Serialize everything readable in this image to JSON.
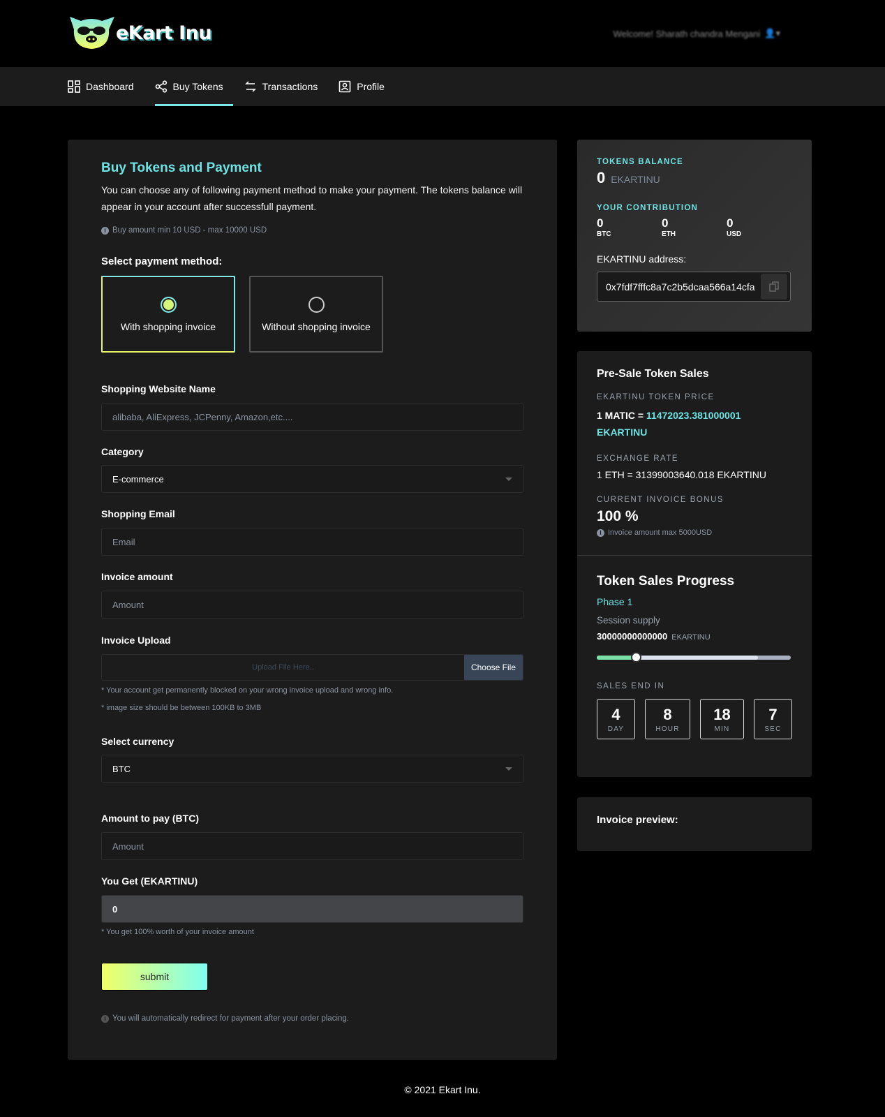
{
  "header": {
    "brand": "eKart Inu",
    "welcome": "Welcome! Sharath chandra Mengani"
  },
  "nav": [
    {
      "label": "Dashboard",
      "icon": "dashboard-icon"
    },
    {
      "label": "Buy Tokens",
      "icon": "share-nodes-icon",
      "active": true
    },
    {
      "label": "Transactions",
      "icon": "arrows-exchange-icon"
    },
    {
      "label": "Profile",
      "icon": "profile-icon"
    }
  ],
  "form": {
    "title": "Buy Tokens and Payment",
    "description": "You can choose any of following payment method to make your payment. The tokens balance will appear in your account after successfull payment.",
    "limit_note": "Buy amount min 10 USD - max 10000 USD",
    "method_label": "Select payment method:",
    "methods": [
      {
        "label": "With shopping invoice",
        "selected": true
      },
      {
        "label": "Without shopping invoice",
        "selected": false
      }
    ],
    "website_label": "Shopping Website Name",
    "website_placeholder": "alibaba, AliExpress, JCPenny, Amazon,etc....",
    "category_label": "Category",
    "category_value": "E-commerce",
    "email_label": "Shopping Email",
    "email_placeholder": "Email",
    "invoice_amount_label": "Invoice amount",
    "invoice_amount_placeholder": "Amount",
    "upload_label": "Invoice Upload",
    "upload_placeholder": "Upload File Here..",
    "choose_file": "Choose File",
    "upload_note1": "* Your account get permanently blocked on your wrong invoice upload and wrong info.",
    "upload_note2": "* image size should be between 100KB to 3MB",
    "currency_label": "Select currency",
    "currency_value": "BTC",
    "pay_label": "Amount to pay (BTC)",
    "pay_placeholder": "Amount",
    "get_label": "You Get (EKARTINU)",
    "get_value": "0",
    "get_note": "* You get 100% worth of your invoice amount",
    "submit": "submit",
    "redirect_note": "You will automatically redirect for payment after your order placing."
  },
  "balance": {
    "caption": "TOKENS BALANCE",
    "value": "0",
    "unit": "EKARTINU",
    "contrib_caption": "YOUR CONTRIBUTION",
    "contrib": [
      {
        "value": "0",
        "unit": "BTC"
      },
      {
        "value": "0",
        "unit": "ETH"
      },
      {
        "value": "0",
        "unit": "USD"
      }
    ],
    "address_label": "EKARTINU address:",
    "address": "0x7fdf7fffc8a7c2b5dcaa566a14cfa"
  },
  "presale": {
    "title": "Pre-Sale Token Sales",
    "price_caption": "EKARTINU TOKEN PRICE",
    "price_prefix": "1 MATIC =",
    "price_value": "11472023.381000001",
    "price_unit": "EKARTINU",
    "rate_caption": "EXCHANGE RATE",
    "rate": "1 ETH = 31399003640.018 EKARTINU",
    "bonus_caption": "CURRENT INVOICE BONUS",
    "bonus": "100 %",
    "bonus_note": "Invoice amount max 5000USD"
  },
  "progress": {
    "title": "Token Sales Progress",
    "phase": "Phase 1",
    "supply_label": "Session supply",
    "supply": "30000000000000",
    "supply_unit": "EKARTINU",
    "progress_percent": 20,
    "soft_cap_percent": 83,
    "ends_caption": "SALES END IN",
    "countdown": [
      {
        "value": "4",
        "unit": "DAY"
      },
      {
        "value": "8",
        "unit": "HOUR"
      },
      {
        "value": "18",
        "unit": "MIN"
      },
      {
        "value": "7",
        "unit": "SEC"
      }
    ]
  },
  "invoice_preview": {
    "title": "Invoice preview:"
  },
  "footer": {
    "copyright": "© 2021 Ekart Inu."
  },
  "colors": {
    "accent": "#6fe3e3",
    "accent2": "#f2ff66",
    "background": "#000000",
    "card": "#1c1c1c"
  }
}
